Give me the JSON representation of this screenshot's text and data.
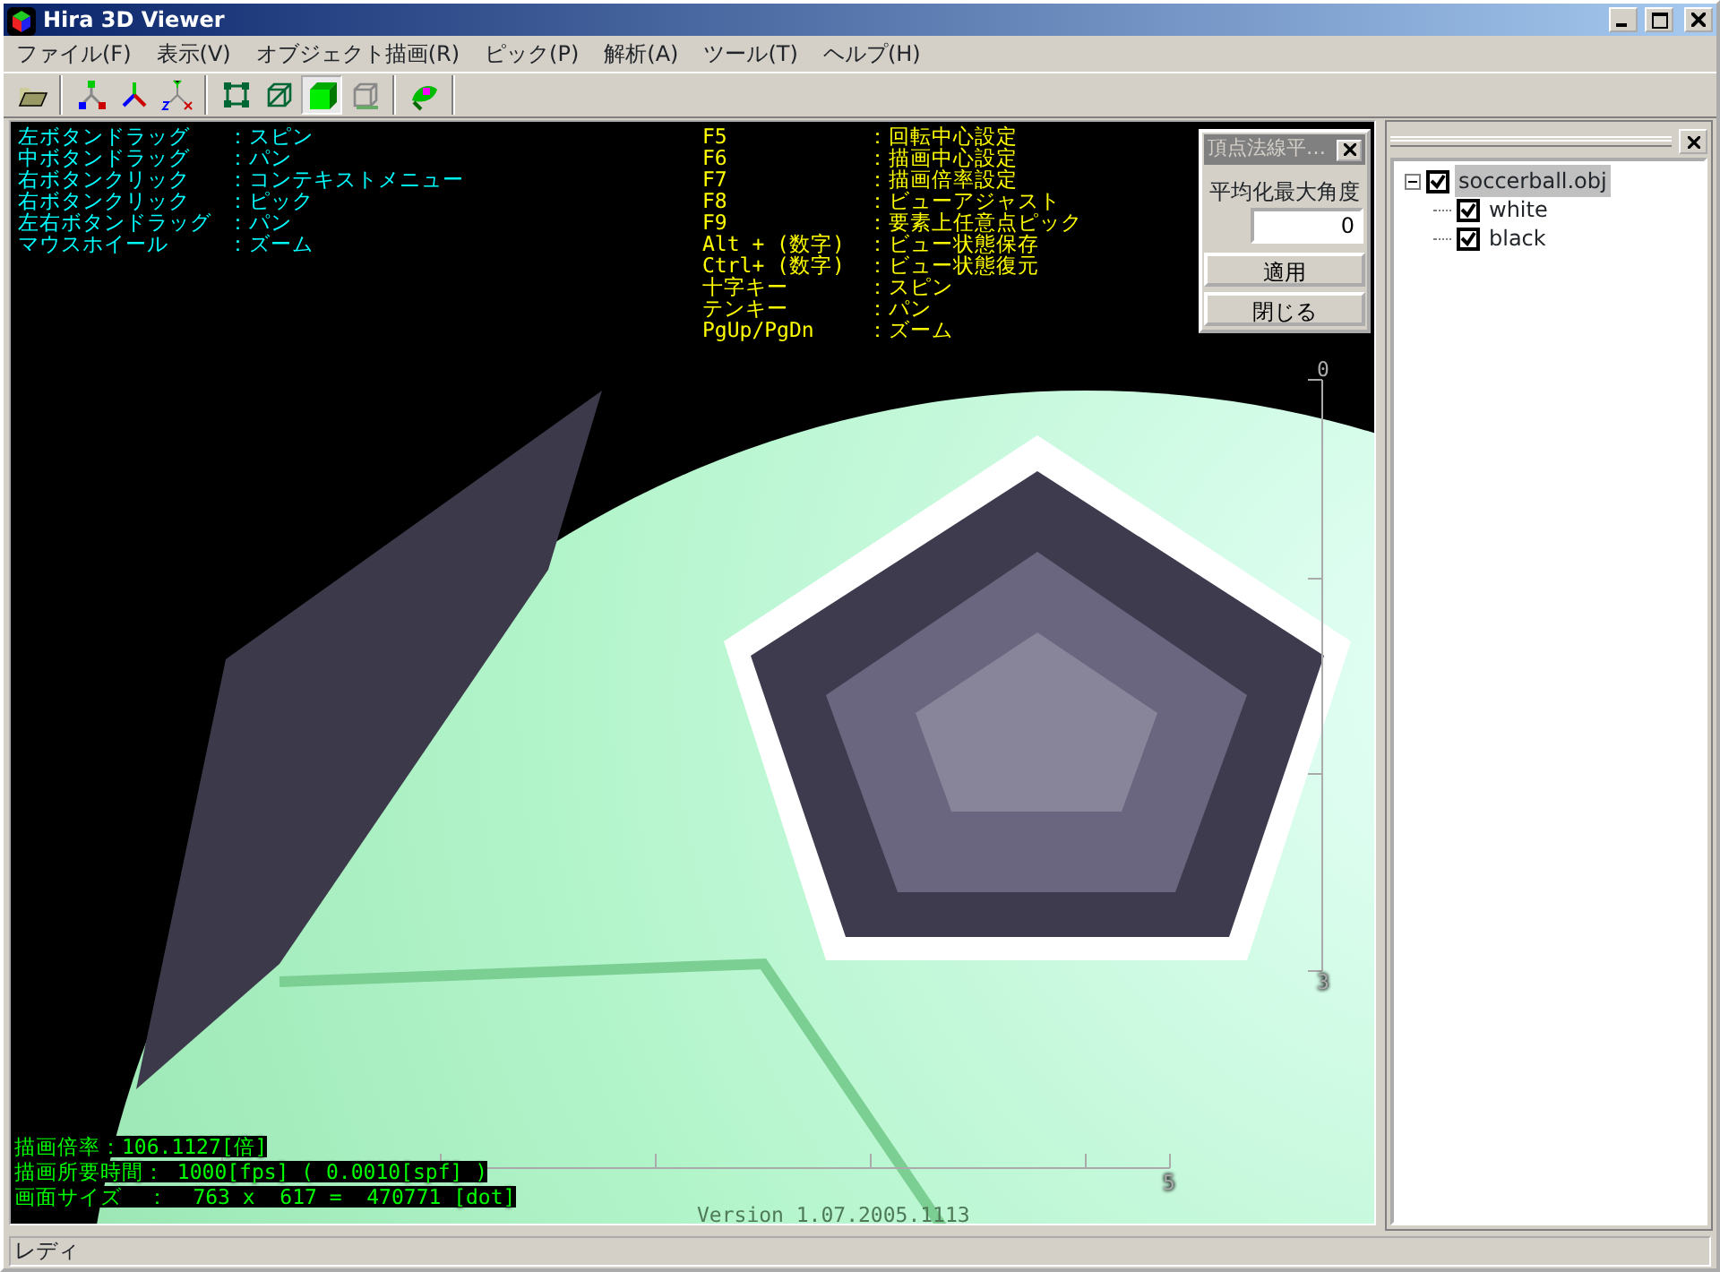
{
  "window": {
    "title": "Hira 3D Viewer"
  },
  "menu": [
    "ファイル(F)",
    "表示(V)",
    "オブジェクト描画(R)",
    "ピック(P)",
    "解析(A)",
    "ツール(T)",
    "ヘルプ(H)"
  ],
  "toolbar": [
    {
      "kind": "open",
      "pressed": false
    },
    {
      "kind": "sep"
    },
    {
      "kind": "axes1",
      "pressed": false
    },
    {
      "kind": "axes2",
      "pressed": false
    },
    {
      "kind": "axes3",
      "pressed": false
    },
    {
      "kind": "sep"
    },
    {
      "kind": "nodes",
      "pressed": false
    },
    {
      "kind": "wire",
      "pressed": false
    },
    {
      "kind": "solid",
      "pressed": true
    },
    {
      "kind": "hidden",
      "pressed": false
    },
    {
      "kind": "sep"
    },
    {
      "kind": "paint",
      "pressed": false
    }
  ],
  "mouse_help": [
    {
      "key": "左ボタンドラッグ",
      "action": "：スピン"
    },
    {
      "key": "中ボタンドラッグ",
      "action": "：パン"
    },
    {
      "key": "右ボタンクリック",
      "action": "：コンテキストメニュー"
    },
    {
      "key": "右ボタンクリック",
      "action": "：ピック"
    },
    {
      "key": "左右ボタンドラッグ",
      "action": "：パン"
    },
    {
      "key": "マウスホイール",
      "action": "：ズーム"
    }
  ],
  "key_help": [
    {
      "key": "F5",
      "action": "：回転中心設定"
    },
    {
      "key": "F6",
      "action": "：描画中心設定"
    },
    {
      "key": "F7",
      "action": "：描画倍率設定"
    },
    {
      "key": "F8",
      "action": "：ビューアジャスト"
    },
    {
      "key": "F9",
      "action": "：要素上任意点ピック"
    },
    {
      "key": "Alt + (数字)",
      "action": "：ビュー状態保存"
    },
    {
      "key": "Ctrl+ (数字)",
      "action": "：ビュー状態復元"
    },
    {
      "key": "十字キー",
      "action": "：スピン"
    },
    {
      "key": "テンキー",
      "action": "：パン"
    },
    {
      "key": "PgUp/PgDn",
      "action": "：ズーム"
    }
  ],
  "vertical_ruler": {
    "start_label": "0",
    "end_label": "3"
  },
  "horizontal_ruler": {
    "end_label": "5"
  },
  "info": [
    "描画倍率：106.1127[倍]",
    "描画所要時間： 1000[fps] ( 0.0010[spf] )",
    "画面サイズ  ：  763 x  617 =  470771 [dot]"
  ],
  "version": "Version 1.07.2005.1113",
  "dialog": {
    "title": "頂点法線平…",
    "label": "平均化最大角度",
    "value": "0",
    "buttons": [
      "適用",
      "閉じる"
    ]
  },
  "tree": [
    {
      "label": "soccerball.obj",
      "checked": true,
      "selected": true,
      "expanded": true,
      "children": [
        {
          "label": "white",
          "checked": true,
          "selected": false
        },
        {
          "label": "black",
          "checked": true,
          "selected": false
        }
      ]
    }
  ],
  "status_bar": "レディ"
}
